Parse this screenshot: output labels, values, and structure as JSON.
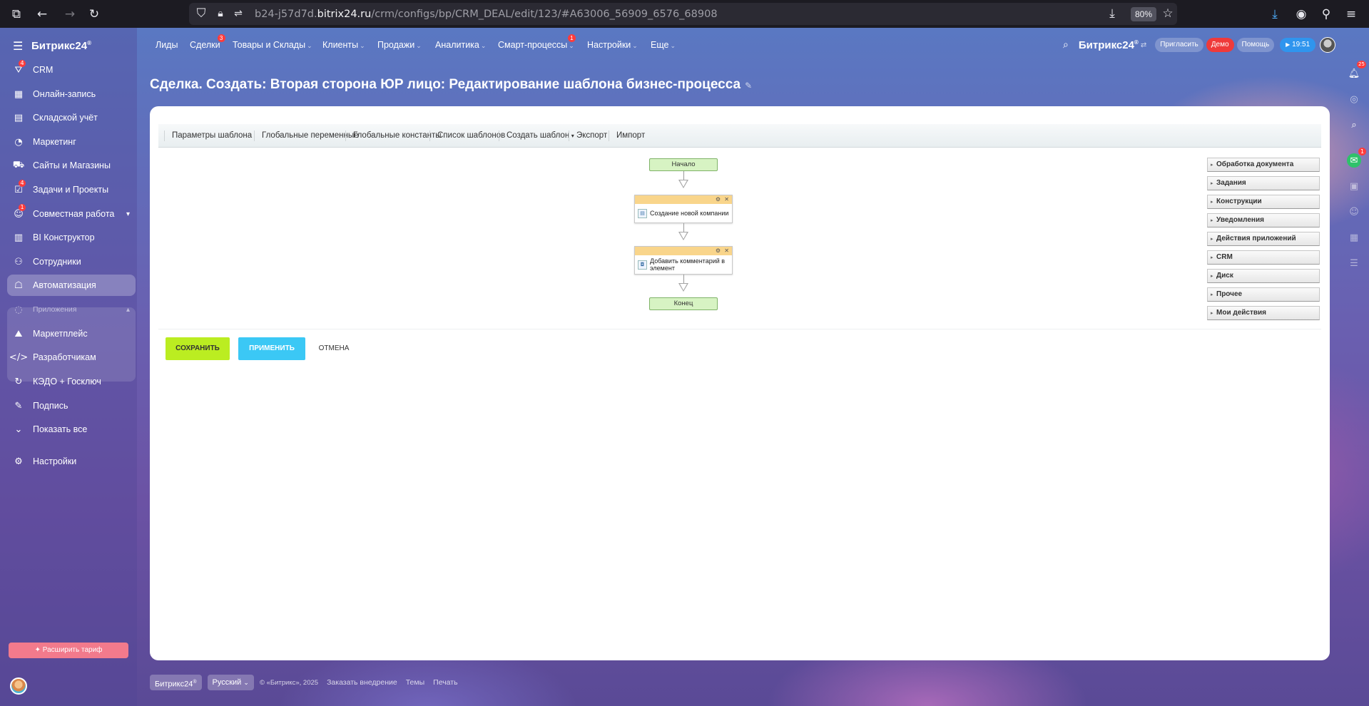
{
  "browser": {
    "url_prefix": "b24-j57d7d.",
    "url_domain": "bitrix24.ru",
    "url_path": "/crm/configs/bp/CRM_DEAL/edit/123/#A63006_56909_6576_68908",
    "zoom": "80%"
  },
  "sidebar": {
    "brand": "Битрикс24",
    "brand_sup": "®",
    "items": [
      {
        "label": "CRM",
        "badge": "4",
        "icon": "crm-icon"
      },
      {
        "label": "Онлайн-запись",
        "icon": "calendar-icon"
      },
      {
        "label": "Складской учёт",
        "icon": "warehouse-icon"
      },
      {
        "label": "Маркетинг",
        "icon": "marketing-icon"
      },
      {
        "label": "Сайты и Магазины",
        "icon": "cart-icon"
      },
      {
        "label": "Задачи и Проекты",
        "badge": "4",
        "icon": "tasks-icon"
      },
      {
        "label": "Совместная работа",
        "badge": "1",
        "icon": "collab-icon"
      },
      {
        "label": "BI Конструктор",
        "icon": "chart-icon"
      },
      {
        "label": "Сотрудники",
        "icon": "employees-icon"
      },
      {
        "label": "Автоматизация",
        "icon": "robot-icon"
      }
    ],
    "apps_label": "Приложения",
    "apps_items": [
      {
        "label": "Маркетплейс",
        "icon": "market-icon"
      },
      {
        "label": "Разработчикам",
        "icon": "code-icon"
      }
    ],
    "more_items": [
      {
        "label": "КЭДО + Госключ",
        "icon": "kedo-icon"
      },
      {
        "label": "Подпись",
        "icon": "sign-icon"
      },
      {
        "label": "Показать все",
        "icon": "chevron-down-icon"
      },
      {
        "label": "Настройки",
        "icon": "gear-icon"
      }
    ],
    "upgrade": "Расширить тариф"
  },
  "topnav": {
    "items": [
      {
        "label": "Лиды"
      },
      {
        "label": "Сделки",
        "badge": "3"
      },
      {
        "label": "Товары и Склады",
        "arrow": true
      },
      {
        "label": "Клиенты",
        "arrow": true
      },
      {
        "label": "Продажи",
        "arrow": true
      },
      {
        "label": "Аналитика",
        "arrow": true
      },
      {
        "label": "Смарт-процессы",
        "arrow": true,
        "badge": "1"
      },
      {
        "label": "Настройки",
        "arrow": true
      },
      {
        "label": "Еще",
        "arrow": true
      }
    ],
    "brand": "Битрикс24",
    "brand_sup": "®",
    "invite": "Пригласить",
    "demo": "Демо",
    "help": "Помощь",
    "time": "19:51",
    "notif_count": "25",
    "chat_count": "1"
  },
  "page": {
    "title": "Сделка. Создать: Вторая сторона ЮР лицо: Редактирование шаблона бизнес-процесса"
  },
  "toolbar": {
    "items": [
      "Параметры шаблона",
      "Глобальные переменные",
      "Глобальные константы",
      "Список шаблонов",
      "Создать шаблон",
      "Экспорт",
      "Импорт"
    ]
  },
  "diagram": {
    "start": "Начало",
    "end": "Конец",
    "activities": [
      "Создание новой компании",
      "Добавить комментарий в элемент"
    ]
  },
  "palette": {
    "groups": [
      "Обработка документа",
      "Задания",
      "Конструкции",
      "Уведомления",
      "Действия приложений",
      "CRM",
      "Диск",
      "Прочее",
      "Мои действия"
    ]
  },
  "buttons": {
    "save": "СОХРАНИТЬ",
    "apply": "ПРИМЕНИТЬ",
    "cancel": "ОТМЕНА"
  },
  "footer": {
    "brand": "Битрикс24",
    "brand_sup": "®",
    "lang": "Русский",
    "copyright": "© «Битрикс», 2025",
    "links": [
      "Заказать внедрение",
      "Темы",
      "Печать"
    ]
  }
}
